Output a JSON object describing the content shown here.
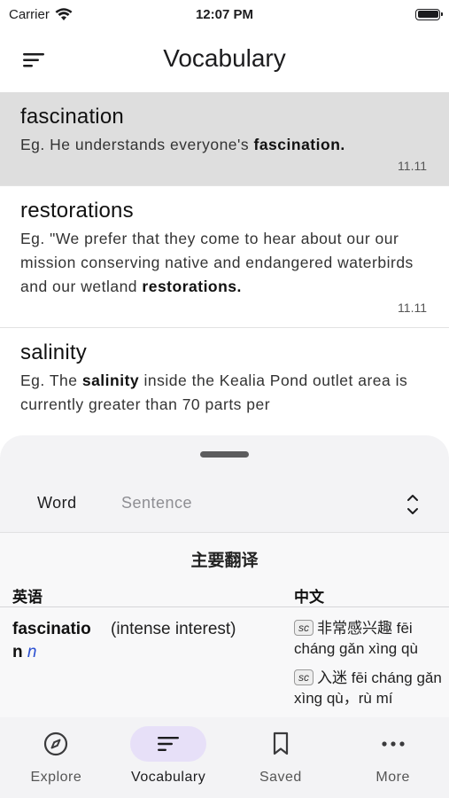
{
  "status_bar": {
    "carrier": "Carrier",
    "time": "12:07 PM"
  },
  "app_bar": {
    "title": "Vocabulary"
  },
  "vocab_items": [
    {
      "word": "fascination",
      "example_prefix": "Eg.  He understands everyone's ",
      "example_highlight": "fascination.",
      "example_suffix": "",
      "date": "11.11"
    },
    {
      "word": "restorations",
      "example_prefix": "Eg.  \"We prefer that they come to hear about our our mission conserving native and endangered waterbirds and our wetland ",
      "example_highlight": "restorations.",
      "example_suffix": "",
      "date": "11.11"
    },
    {
      "word": "salinity",
      "example_prefix": "Eg.  The ",
      "example_highlight": "salinity",
      "example_suffix": " inside the Kealia Pond outlet area is currently greater than 70 parts per",
      "date": ""
    }
  ],
  "sheet": {
    "tabs": {
      "word": "Word",
      "sentence": "Sentence"
    },
    "translation": {
      "heading": "主要翻译",
      "col_en": "英语",
      "col_zh": "中文",
      "row": {
        "word": "fascinatio n",
        "pos": "n",
        "definition": "(intense interest)",
        "entries": [
          {
            "badge": "sc",
            "text": "非常感兴趣 fēi cháng gǎn xìng qù"
          },
          {
            "badge": "sc",
            "text": "入迷 fēi cháng gǎn xìng qù，rù mí"
          }
        ]
      }
    }
  },
  "bottom_nav": {
    "items": [
      {
        "label": "Explore",
        "icon": "compass-icon"
      },
      {
        "label": "Vocabulary",
        "icon": "sort-lines-icon",
        "active": true
      },
      {
        "label": "Saved",
        "icon": "bookmark-icon"
      },
      {
        "label": "More",
        "icon": "more-dots-icon"
      }
    ]
  },
  "colors": {
    "accent_pill": "#e7e0f8",
    "selected_row": "#dedede",
    "pos_blue": "#2a4fd1"
  }
}
